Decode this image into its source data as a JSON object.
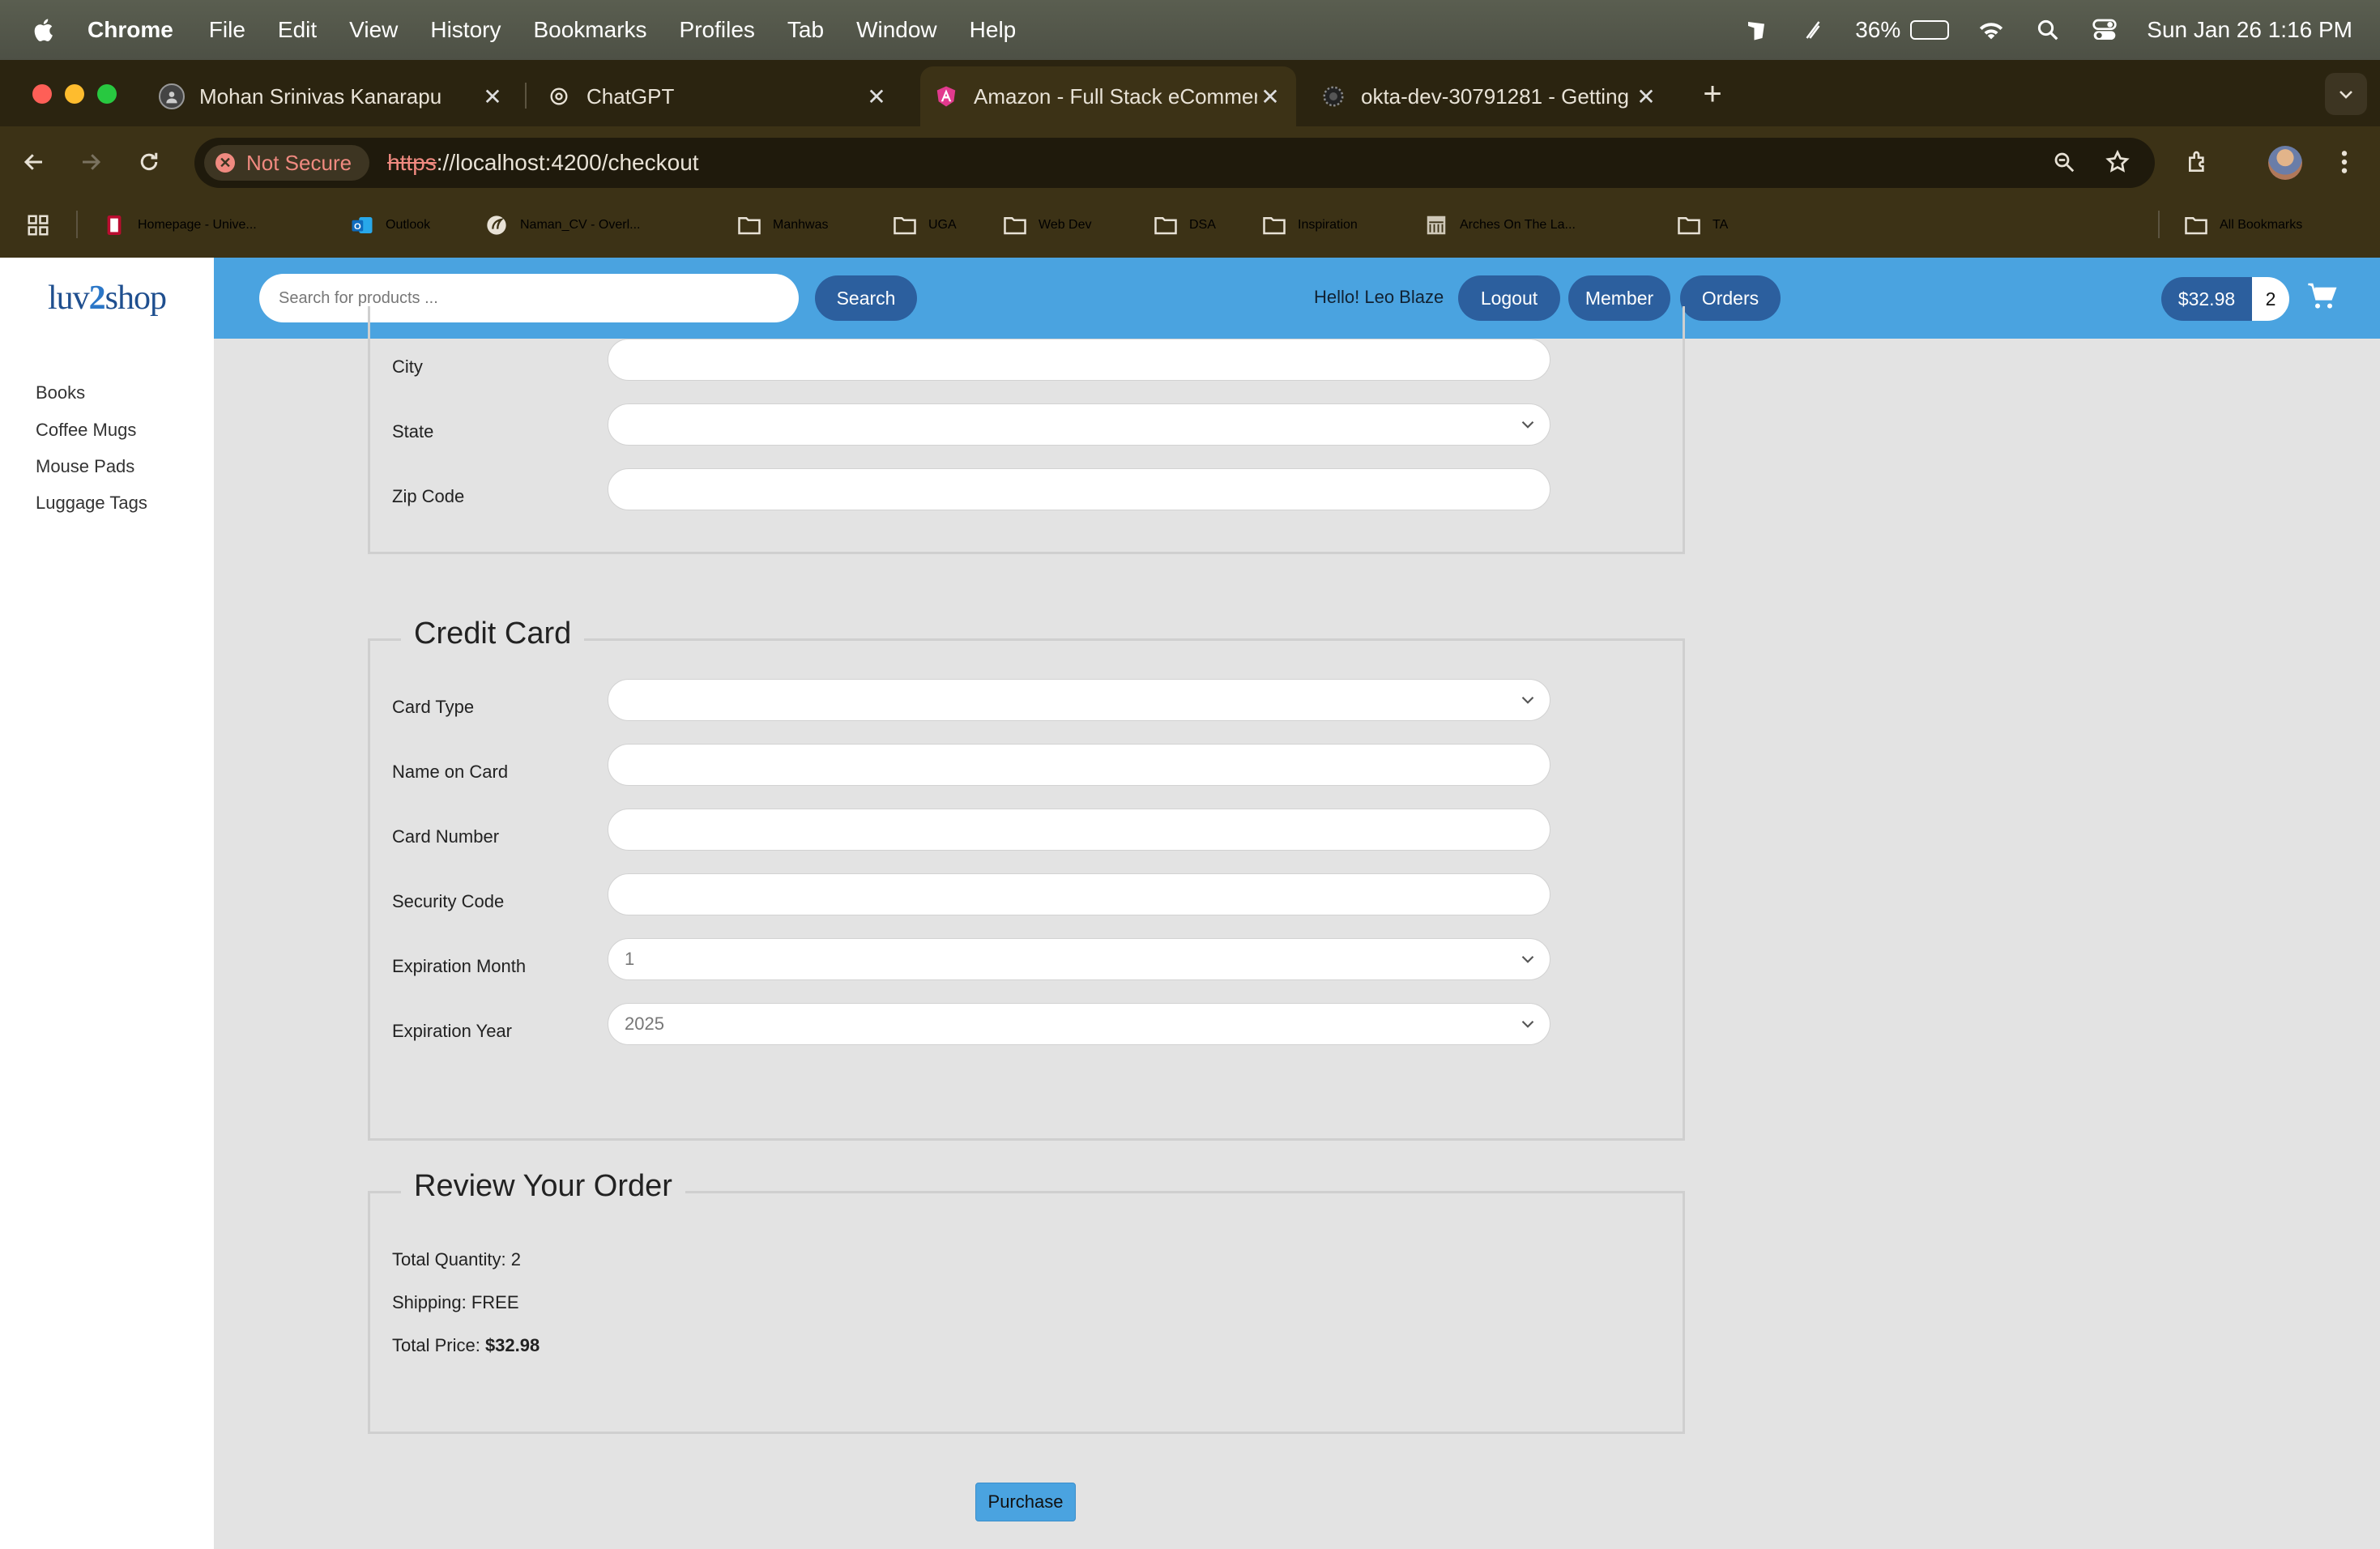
{
  "menubar": {
    "app_name": "Chrome",
    "items": [
      "File",
      "Edit",
      "View",
      "History",
      "Bookmarks",
      "Profiles",
      "Tab",
      "Window",
      "Help"
    ],
    "battery": "36%",
    "battery_level": 0.36,
    "datetime": "Sun Jan 26  1:16 PM"
  },
  "tabs": [
    {
      "title": "Mohan Srinivas Kanarapu",
      "active": false
    },
    {
      "title": "ChatGPT",
      "active": false
    },
    {
      "title": "Amazon - Full Stack eCommerce",
      "active": true
    },
    {
      "title": "okta-dev-30791281 - Getting",
      "active": false
    }
  ],
  "toolbar": {
    "security_label": "Not Secure",
    "url_scheme": "https",
    "url_rest": "://localhost:4200/checkout"
  },
  "bookmarks": [
    {
      "label": "Homepage - Unive...",
      "icon": "uga-icon"
    },
    {
      "label": "Outlook",
      "icon": "outlook-icon"
    },
    {
      "label": "Naman_CV - Overl...",
      "icon": "overleaf-icon"
    },
    {
      "label": "Manhwas",
      "icon": "folder-icon"
    },
    {
      "label": "UGA",
      "icon": "folder-icon"
    },
    {
      "label": "Web Dev",
      "icon": "folder-icon"
    },
    {
      "label": "DSA",
      "icon": "folder-icon"
    },
    {
      "label": "Inspiration",
      "icon": "folder-icon"
    },
    {
      "label": "Arches On The La...",
      "icon": "building-icon"
    },
    {
      "label": "TA",
      "icon": "folder-icon"
    }
  ],
  "all_bookmarks": "All Bookmarks",
  "header": {
    "logo_left": "luv",
    "logo_mid": "2",
    "logo_right": "shop",
    "search_placeholder": "Search for products ...",
    "search_button": "Search",
    "greeting": "Hello! Leo Blaze",
    "logout": "Logout",
    "member": "Member",
    "orders": "Orders",
    "cart_total": "$32.98",
    "cart_quantity": "2"
  },
  "sidebar": {
    "items": [
      "Books",
      "Coffee Mugs",
      "Mouse Pads",
      "Luggage Tags"
    ]
  },
  "address_section": {
    "fields": [
      {
        "label": "City",
        "value": "",
        "type": "text"
      },
      {
        "label": "State",
        "value": "",
        "type": "select"
      },
      {
        "label": "Zip Code",
        "value": "",
        "type": "text"
      }
    ]
  },
  "credit_card": {
    "legend": "Credit Card",
    "fields": [
      {
        "label": "Card Type",
        "value": "",
        "type": "select"
      },
      {
        "label": "Name on Card",
        "value": "",
        "type": "text"
      },
      {
        "label": "Card Number",
        "value": "",
        "type": "text"
      },
      {
        "label": "Security Code",
        "value": "",
        "type": "text"
      },
      {
        "label": "Expiration Month",
        "value": "1",
        "type": "select"
      },
      {
        "label": "Expiration Year",
        "value": "2025",
        "type": "select"
      }
    ]
  },
  "review": {
    "legend": "Review Your Order",
    "total_quantity_label": "Total Quantity: ",
    "total_quantity": "2",
    "shipping_label": "Shipping: ",
    "shipping": "FREE",
    "total_price_label": "Total Price: ",
    "total_price": "$32.98"
  },
  "purchase_button": "Purchase",
  "colors": {
    "header_blue": "#4aa3e0",
    "button_navy": "#2c5f9e",
    "not_secure": "#f08a80"
  }
}
